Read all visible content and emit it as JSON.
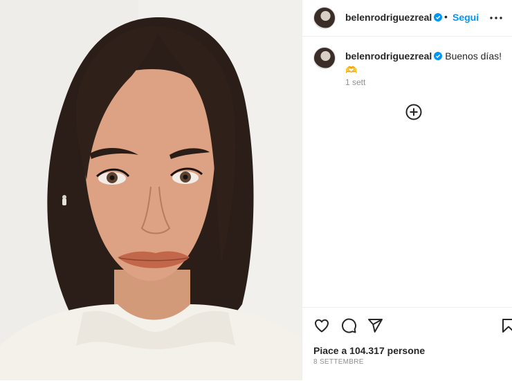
{
  "post": {
    "author": "belenrodriguezreal",
    "follow_label": "Segui",
    "separator": "•",
    "caption": "Buenos días!",
    "caption_emoji": "🫶",
    "time_ago": "1 sett",
    "likes_text": "Piace a 104.317 persone",
    "date": "8 SETTEMBRE"
  },
  "icons": {
    "verified": "verified-badge-icon",
    "more": "more-options-icon",
    "load_more": "plus-circle-icon",
    "like": "heart-icon",
    "comment": "comment-icon",
    "share": "send-icon",
    "save": "bookmark-icon"
  },
  "colors": {
    "accent": "#0095f6",
    "text": "#262626",
    "muted": "#8e8e8e",
    "border": "#efefef"
  }
}
